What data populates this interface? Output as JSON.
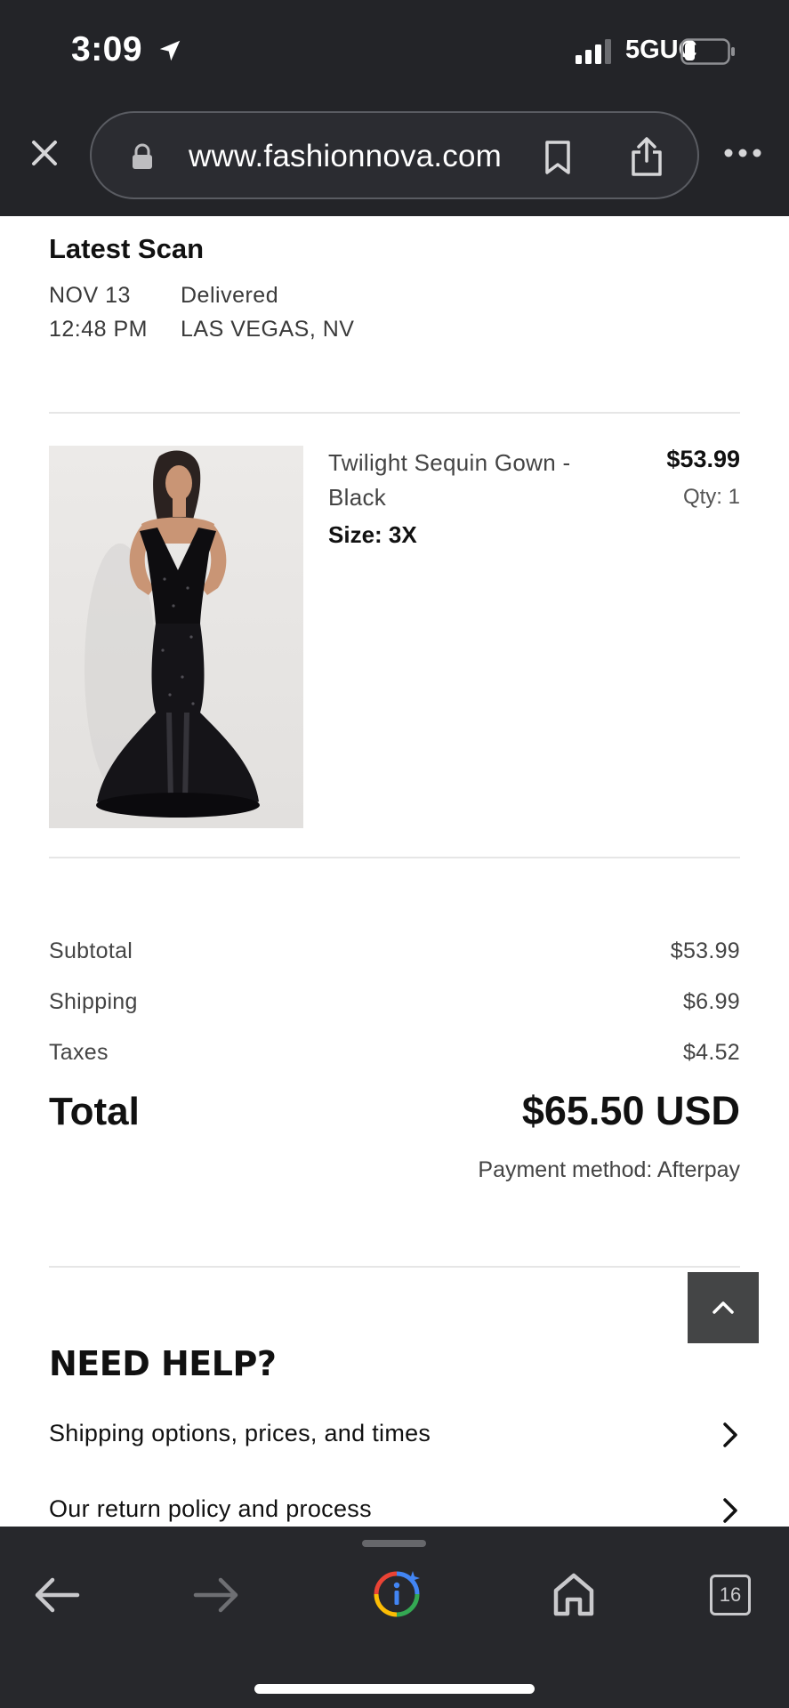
{
  "status_bar": {
    "time": "3:09",
    "network": "5GUC"
  },
  "browser": {
    "url": "www.fashionnova.com",
    "tab_count": "16"
  },
  "tracking": {
    "heading": "Latest Scan",
    "date": "NOV 13",
    "time": "12:48 PM",
    "status": "Delivered",
    "location": "LAS VEGAS, NV"
  },
  "product": {
    "name": "Twilight Sequin Gown - Black",
    "size_label": "Size:",
    "size_value": "3X",
    "price": "$53.99",
    "qty": "Qty: 1"
  },
  "summary": {
    "subtotal_label": "Subtotal",
    "subtotal": "$53.99",
    "shipping_label": "Shipping",
    "shipping": "$6.99",
    "taxes_label": "Taxes",
    "taxes": "$4.52",
    "total_label": "Total",
    "total": "$65.50 USD",
    "payment_method": "Payment method: Afterpay"
  },
  "help": {
    "title": "NEED HELP?",
    "items": [
      {
        "label": "Shipping options, prices, and times"
      },
      {
        "label": "Our return policy and process"
      }
    ]
  },
  "colors": {
    "chrome_bg": "#232428",
    "toolbar_bg": "#27282c",
    "text": "#111111",
    "muted": "#444444"
  }
}
